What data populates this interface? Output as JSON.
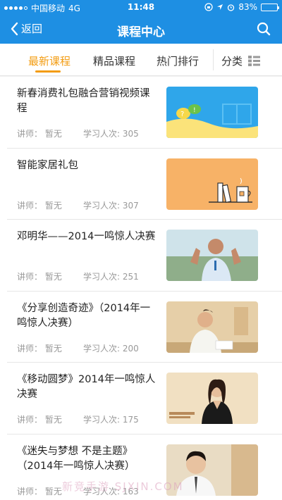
{
  "status": {
    "carrier": "中国移动",
    "network": "4G",
    "time": "11:48",
    "battery": "83%",
    "battery_level": 0.83
  },
  "nav": {
    "back_label": "返回",
    "title": "课程中心"
  },
  "tabs": [
    {
      "label": "最新课程",
      "active": true
    },
    {
      "label": "精品课程",
      "active": false
    },
    {
      "label": "热门排行",
      "active": false
    }
  ],
  "category_label": "分类",
  "courses": [
    {
      "title": "新春消费礼包融合营销视频课程",
      "teacher": "讲师：  暂无",
      "learners": "学习人次: 305",
      "thumb": "chat-bubbles-illustration"
    },
    {
      "title": "智能家居礼包",
      "teacher": "讲师：  暂无",
      "learners": "学习人次: 307",
      "thumb": "books-mug-illustration"
    },
    {
      "title": "邓明华——2014一鸣惊人决赛",
      "teacher": "讲师：  暂无",
      "learners": "学习人次: 251",
      "thumb": "speaker-photo"
    },
    {
      "title": "《分享创造奇迹》（2014年一鸣惊人决赛）",
      "teacher": "讲师：  暂无",
      "learners": "学习人次: 200",
      "thumb": "speaker-photo"
    },
    {
      "title": "《移动圆梦》2014年一鸣惊人决赛",
      "teacher": "讲师：  暂无",
      "learners": "学习人次: 175",
      "thumb": "speaker-photo"
    },
    {
      "title": "《迷失与梦想 不是主题》（2014年一鸣惊人决赛）",
      "teacher": "讲师：  暂无",
      "learners": "学习人次: 163",
      "thumb": "speaker-photo"
    }
  ],
  "watermark": "新竞手游 SJXIN.COM",
  "colors": {
    "brand": "#1e8fe3",
    "accent": "#f39c12"
  }
}
